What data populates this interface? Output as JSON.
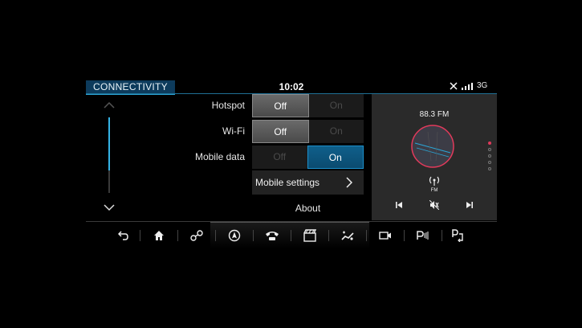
{
  "header": {
    "title": "CONNECTIVITY",
    "clock": "10:02",
    "network": "3G"
  },
  "settings": {
    "hotspot": {
      "label": "Hotspot",
      "off": "Off",
      "on": "On",
      "value": "Off"
    },
    "wifi": {
      "label": "Wi-Fi",
      "off": "Off",
      "on": "On",
      "value": "Off"
    },
    "mobile_data": {
      "label": "Mobile data",
      "off": "Off",
      "on": "On",
      "value": "On"
    },
    "mobile_settings_label": "Mobile settings",
    "about_label": "About"
  },
  "radio": {
    "frequency": "88.3 FM",
    "band": "FM"
  },
  "colors": {
    "accent": "#2aa6d8",
    "active_blue": "#0f5f8a",
    "radio_ring": "#e23a5b"
  },
  "nav": {
    "icons": [
      "back-icon",
      "home-icon",
      "connections-icon",
      "navigation-icon",
      "phone-icon",
      "media-icon",
      "climate-icon",
      "camera-icon",
      "parking-icon",
      "park-assist-icon"
    ]
  }
}
